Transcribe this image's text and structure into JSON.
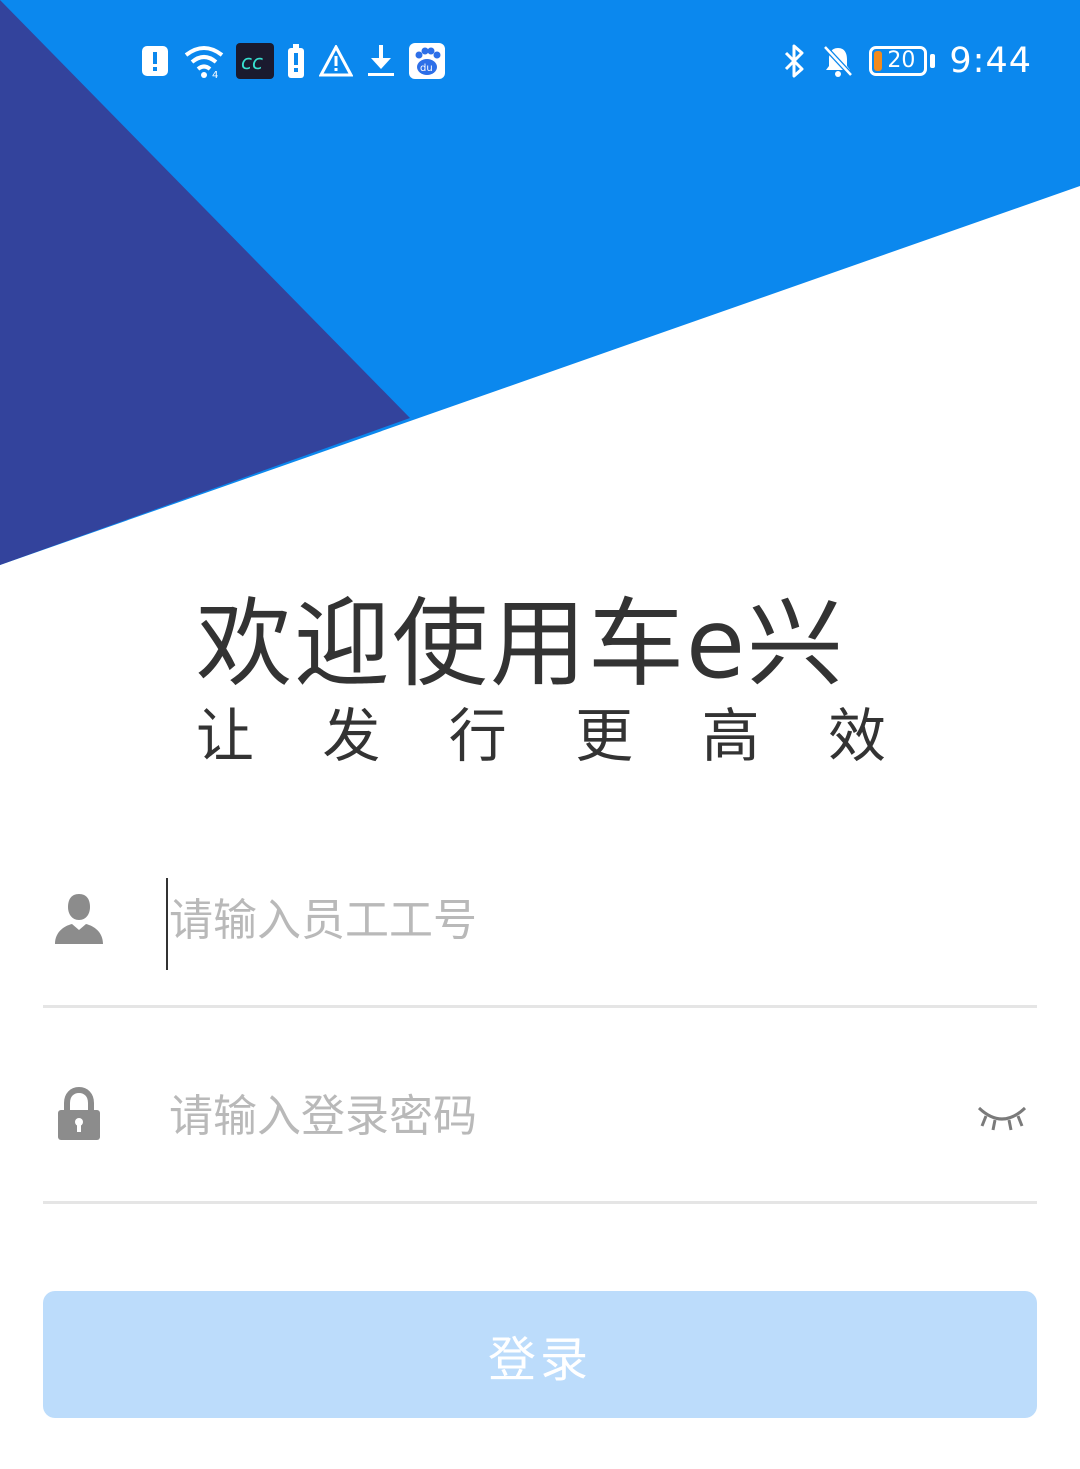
{
  "colors": {
    "hero_light_blue": "#0b88ee",
    "hero_dark_blue": "#33439c",
    "login_button_bg": "#bcdcfb",
    "text_dark": "#333333",
    "placeholder": "#b9b9b9",
    "divider": "#e5e5e5",
    "icon_gray": "#8c8c8c"
  },
  "status_bar": {
    "left_icons": [
      "alert-icon",
      "wifi-icon",
      "cc-app-icon",
      "battery-alert-icon",
      "warning-icon",
      "download-icon",
      "baidu-icon"
    ],
    "right_icons": [
      "bluetooth-icon",
      "mute-bell-icon",
      "battery-icon"
    ],
    "battery_level": "20",
    "time": "9:44"
  },
  "welcome": {
    "title": "欢迎使用车e兴",
    "slogan_chars": [
      "让",
      "发",
      "行",
      "更",
      "高",
      "效"
    ]
  },
  "form": {
    "username_placeholder": "请输入员工工号",
    "password_placeholder": "请输入登录密码",
    "username_icon": "user-icon",
    "password_icon": "lock-icon",
    "toggle_icon": "eye-closed-icon"
  },
  "login_button": {
    "label": "登录"
  }
}
